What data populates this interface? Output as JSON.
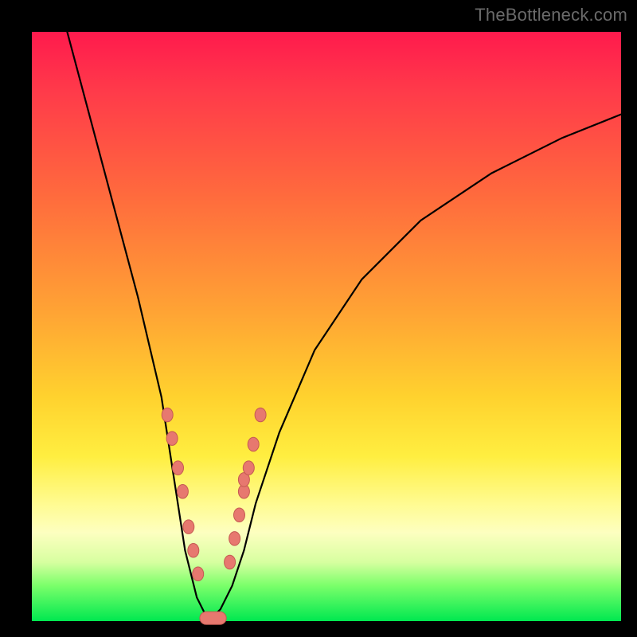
{
  "watermark": "TheBottleneck.com",
  "chart_data": {
    "type": "line",
    "title": "",
    "xlabel": "",
    "ylabel": "",
    "xlim": [
      0,
      100
    ],
    "ylim": [
      0,
      100
    ],
    "description": "V-shaped bottleneck curve on vertical red-to-green gradient; minimum near x≈30 at y≈0, rising steeply to both sides.",
    "series": [
      {
        "name": "curve",
        "x": [
          6,
          10,
          14,
          18,
          22,
          24,
          26,
          28,
          30,
          32,
          34,
          36,
          38,
          42,
          48,
          56,
          66,
          78,
          90,
          100
        ],
        "y": [
          100,
          85,
          70,
          55,
          38,
          25,
          12,
          4,
          0,
          2,
          6,
          12,
          20,
          32,
          46,
          58,
          68,
          76,
          82,
          86
        ]
      }
    ],
    "markers": {
      "left_branch": [
        {
          "x": 23.0,
          "y": 35
        },
        {
          "x": 23.8,
          "y": 31
        },
        {
          "x": 24.8,
          "y": 26
        },
        {
          "x": 25.6,
          "y": 22
        },
        {
          "x": 26.6,
          "y": 16
        },
        {
          "x": 27.4,
          "y": 12
        },
        {
          "x": 28.2,
          "y": 8
        }
      ],
      "right_branch": [
        {
          "x": 33.6,
          "y": 10
        },
        {
          "x": 34.4,
          "y": 14
        },
        {
          "x": 35.2,
          "y": 18
        },
        {
          "x": 36.0,
          "y": 22
        },
        {
          "x": 36.0,
          "y": 24
        },
        {
          "x": 36.8,
          "y": 26
        },
        {
          "x": 37.6,
          "y": 30
        },
        {
          "x": 38.8,
          "y": 35
        }
      ],
      "bottom_pill": {
        "x0": 28.5,
        "x1": 33.0,
        "y": 0.5
      }
    },
    "gradient_stops": [
      {
        "pos": 0,
        "color": "#ff1a4d"
      },
      {
        "pos": 28,
        "color": "#ff6b3d"
      },
      {
        "pos": 62,
        "color": "#ffd22e"
      },
      {
        "pos": 85,
        "color": "#fdffc0"
      },
      {
        "pos": 100,
        "color": "#00e850"
      }
    ]
  }
}
